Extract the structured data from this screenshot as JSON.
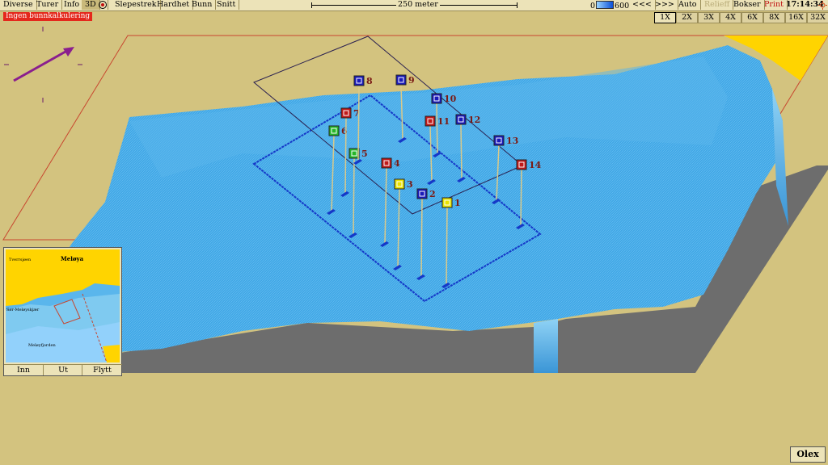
{
  "menu": [
    "Diverse",
    "Turer",
    "Info",
    "3D",
    "",
    "Slepestrek",
    "Hardhet",
    "Bunn",
    "Snitt"
  ],
  "scale_label": "250 meter",
  "depth": {
    "min": "0",
    "max": "600"
  },
  "nav_buttons": [
    "<<<",
    ">>>",
    "Auto",
    "Relieff",
    "Bokser",
    "Print"
  ],
  "clock": "17:14:34",
  "status_warning": "Ingen bunnkalkulering",
  "zoom_options": [
    "1X",
    "2X",
    "3X",
    "4X",
    "6X",
    "8X",
    "16X",
    "32X"
  ],
  "zoom_selected": "1X",
  "inset": {
    "labels": {
      "island": "Meløya",
      "west": "Tverrsjøen",
      "place": "Sør-Meløyskjær",
      "bottom": "Meløyfjorden"
    },
    "buttons": [
      "Inn",
      "Ut",
      "Flytt"
    ]
  },
  "waypoints": [
    {
      "id": "1",
      "color": "yellow"
    },
    {
      "id": "2",
      "color": "blue"
    },
    {
      "id": "3",
      "color": "yellow"
    },
    {
      "id": "4",
      "color": "red"
    },
    {
      "id": "5",
      "color": "green"
    },
    {
      "id": "6",
      "color": "green"
    },
    {
      "id": "7",
      "color": "red"
    },
    {
      "id": "8",
      "color": "blue"
    },
    {
      "id": "9",
      "color": "blue"
    },
    {
      "id": "10",
      "color": "blue"
    },
    {
      "id": "11",
      "color": "red"
    },
    {
      "id": "12",
      "color": "blue"
    },
    {
      "id": "13",
      "color": "blue"
    },
    {
      "id": "14",
      "color": "red"
    }
  ],
  "logo": "Olex",
  "colors": {
    "sea": "#41a7e6",
    "land": "#ffd400",
    "background": "#d3c37f",
    "warning": "#e4281c"
  }
}
